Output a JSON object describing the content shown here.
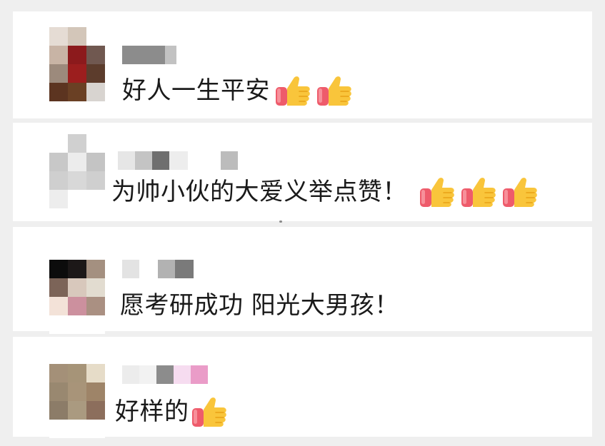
{
  "comments": [
    {
      "text": "好人一生平安",
      "thumbs": 2,
      "avatar_cells": [
        "#e5dcd4",
        "#d3c6b9",
        "#ffffff",
        "#c8b4a5",
        "#8c1a1c",
        "#705850",
        "#9c8a7c",
        "#9c1e1e",
        "#5c3c2c",
        "#5c3420",
        "#6a4024",
        "#d8d4d0"
      ],
      "name_blocks": [
        [
          "#8c8c8c",
          60
        ],
        [
          "#c2c2c2",
          16
        ]
      ]
    },
    {
      "text": "为帅小伙的大爱义举点赞！",
      "thumbs": 3,
      "avatar_cells": [
        "#ffffff",
        "#d0d0d0",
        "#ffffff",
        "#c8c8c8",
        "#ececec",
        "#c4c4c4",
        "#cfcfcf",
        "#d8d8d8",
        "#cfcfcf",
        "#ededed",
        "#ffffff",
        "#ffffff"
      ],
      "name_blocks": [
        [
          "#e6e6e6",
          24
        ],
        [
          "#c4c4c4",
          24
        ],
        [
          "#6f6f6f",
          24
        ],
        [
          "#ededed",
          26
        ],
        [
          "#ffffff",
          46
        ],
        [
          "#bcbcbc",
          24
        ]
      ]
    },
    {
      "text": "愿考研成功 阳光大男孩！",
      "thumbs": 0,
      "avatar_cells": [
        "#0c0c0c",
        "#1c1818",
        "#a49080",
        "#7c6458",
        "#d8c8bc",
        "#e2dcd0",
        "#f3e2d8",
        "#cc909e",
        "#aa9082",
        "#ffffff",
        "#ffffff",
        "#ffffff"
      ],
      "name_blocks": [
        [
          "#e3e3e3",
          24
        ],
        [
          "#ffffff",
          26
        ],
        [
          "#b2b2b2",
          24
        ],
        [
          "#7a7a7a",
          26
        ]
      ]
    },
    {
      "text": "好样的",
      "thumbs": 1,
      "avatar_cells": [
        "#a49078",
        "#a69478",
        "#e6dcc8",
        "#998870",
        "#a89479",
        "#9e8468",
        "#8c7c68",
        "#aa9a80",
        "#8c6e5c",
        "#ffffff",
        "#ffffff",
        "#ffffff"
      ],
      "name_blocks": [
        [
          "#ececec",
          24
        ],
        [
          "#f2f2f2",
          24
        ],
        [
          "#8c8c8c",
          24
        ],
        [
          "#f6dcf0",
          24
        ],
        [
          "#ea9cc8",
          24
        ]
      ]
    }
  ],
  "colors": {
    "background": "#efefef",
    "card": "#ffffff",
    "text": "#1a1a1a",
    "thumb_skin": "#f9c53b",
    "thumb_sleeve": "#ee5b6b"
  },
  "icons": {
    "thumbs_up": "thumbs-up-icon"
  }
}
